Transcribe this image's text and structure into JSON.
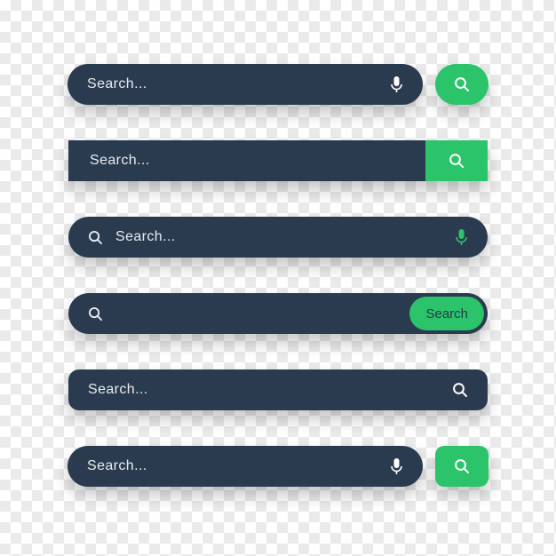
{
  "colors": {
    "accent": "#2bc46a",
    "bar": "#2b3b4f",
    "text": "#e8ebef"
  },
  "bars": {
    "b1": {
      "placeholder": "Search..."
    },
    "b2": {
      "placeholder": "Search..."
    },
    "b3": {
      "placeholder": "Search..."
    },
    "b4": {
      "button_label": "Search"
    },
    "b5": {
      "placeholder": "Search..."
    },
    "b6": {
      "placeholder": "Search..."
    }
  }
}
